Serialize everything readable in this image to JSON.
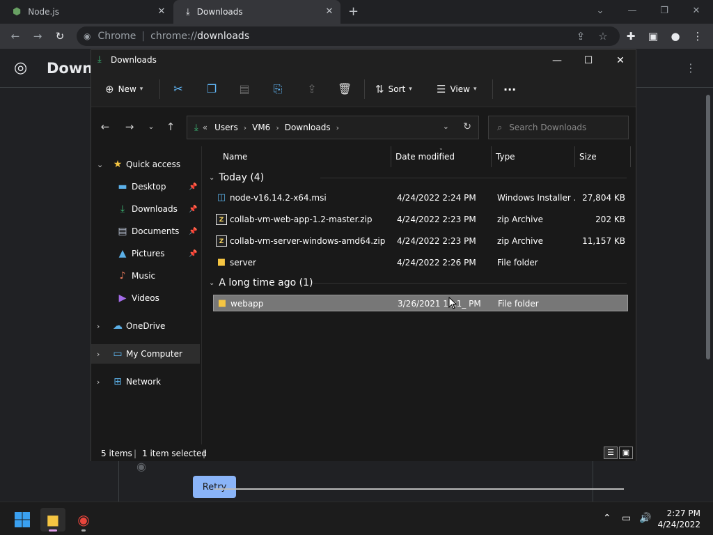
{
  "browser": {
    "tabs": [
      {
        "title": "Node.js",
        "icon": "nodejs-icon"
      },
      {
        "title": "Downloads",
        "icon": "download-icon"
      }
    ],
    "omnibox": {
      "scheme_label": "Chrome",
      "url_scheme": "chrome://",
      "url_host": "downloads"
    },
    "page": {
      "title": "Downl",
      "retry_label": "Retry"
    }
  },
  "explorer": {
    "title": "Downloads",
    "commands": {
      "new_label": "New",
      "sort_label": "Sort",
      "view_label": "View",
      "more_label": "···"
    },
    "address": {
      "prefix": "«",
      "crumbs": [
        "Users",
        "VM6",
        "Downloads"
      ]
    },
    "search_placeholder": "Search Downloads",
    "sidebar": {
      "quick_access": "Quick access",
      "items": [
        {
          "label": "Desktop",
          "icon": "desktop-icon"
        },
        {
          "label": "Downloads",
          "icon": "downloads-icon"
        },
        {
          "label": "Documents",
          "icon": "documents-icon"
        },
        {
          "label": "Pictures",
          "icon": "pictures-icon"
        },
        {
          "label": "Music",
          "icon": "music-icon"
        },
        {
          "label": "Videos",
          "icon": "videos-icon"
        }
      ],
      "onedrive": "OneDrive",
      "my_computer": "My Computer",
      "network": "Network"
    },
    "columns": {
      "name": "Name",
      "date": "Date modified",
      "type": "Type",
      "size": "Size"
    },
    "groups": [
      {
        "label": "Today (4)",
        "rows": [
          {
            "name": "node-v16.14.2-x64.msi",
            "date": "4/24/2022 2:24 PM",
            "type": "Windows Installer ...",
            "size": "27,804 KB",
            "icon": "msi-icon"
          },
          {
            "name": "collab-vm-web-app-1.2-master.zip",
            "date": "4/24/2022 2:23 PM",
            "type": "zip Archive",
            "size": "202 KB",
            "icon": "zip-icon"
          },
          {
            "name": "collab-vm-server-windows-amd64.zip",
            "date": "4/24/2022 2:23 PM",
            "type": "zip Archive",
            "size": "11,157 KB",
            "icon": "zip-icon"
          },
          {
            "name": "server",
            "date": "4/24/2022 2:26 PM",
            "type": "File folder",
            "size": "",
            "icon": "folder-icon"
          }
        ]
      },
      {
        "label": "A long time ago (1)",
        "rows": [
          {
            "name": "webapp",
            "date": "3/26/2021 10:1_ PM",
            "type": "File folder",
            "size": "",
            "icon": "folder-icon"
          }
        ]
      }
    ],
    "status": {
      "items": "5 items",
      "selected": "1 item selected"
    }
  },
  "taskbar": {
    "time": "2:27 PM",
    "date": "4/24/2022"
  },
  "colors": {
    "accent": "#8ab4f8",
    "folder": "#f5c542",
    "selection": "#777777"
  }
}
